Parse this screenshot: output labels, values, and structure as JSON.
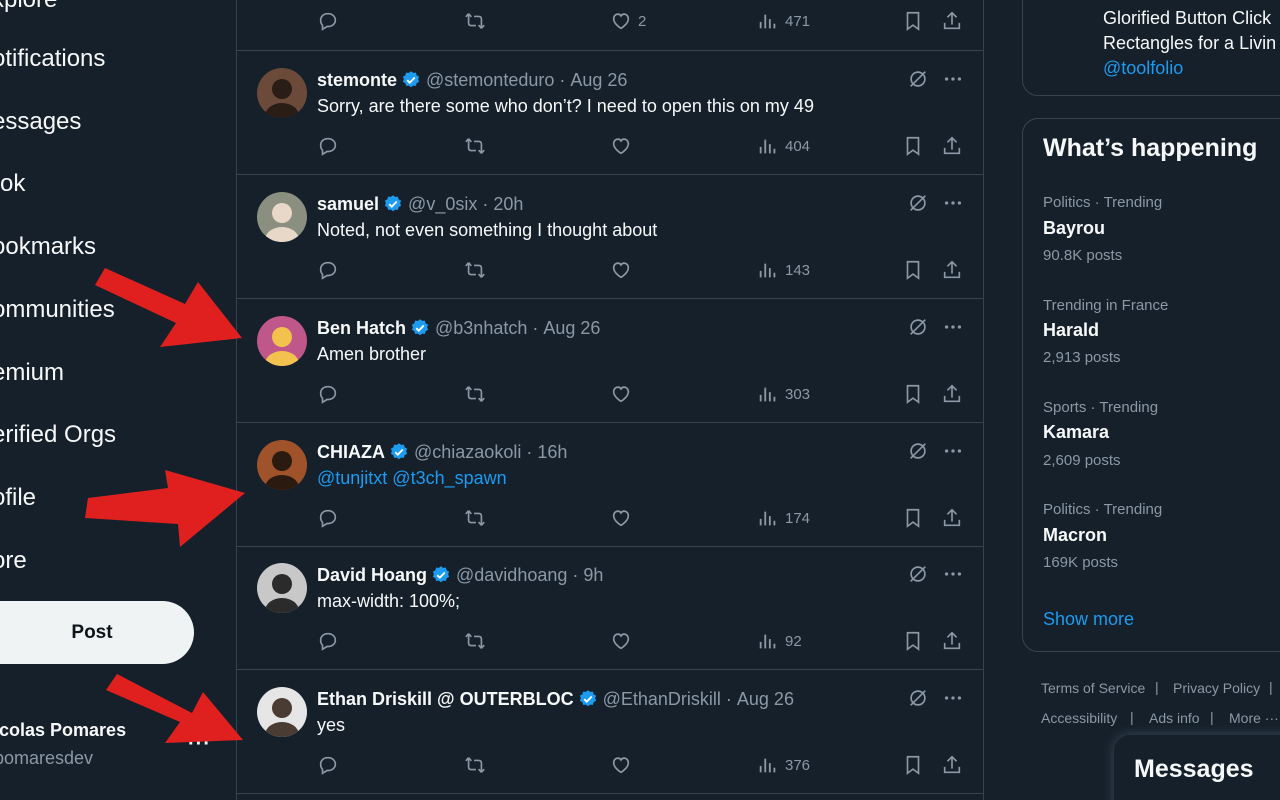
{
  "nav": {
    "items": [
      {
        "label": "xplore"
      },
      {
        "label": "otifications"
      },
      {
        "label": "essages"
      },
      {
        "label": "rok"
      },
      {
        "label": "ookmarks"
      },
      {
        "label": "ommunities"
      },
      {
        "label": "emium"
      },
      {
        "label": "erified Orgs"
      },
      {
        "label": "ofile"
      },
      {
        "label": "ore"
      }
    ],
    "post_label": "Post",
    "account_name": "icolas Pomares",
    "account_handle": "pomaresdev",
    "account_more": "···"
  },
  "feed": {
    "top_actions": {
      "likes": "2",
      "views": "471"
    },
    "tweets": [
      {
        "name": "stemonte",
        "handle": "@stemonteduro",
        "dot": "·",
        "time": "Aug 26",
        "text": "Sorry, are there some who don’t? I need to open this on my 49",
        "views": "404"
      },
      {
        "name": "samuel",
        "handle": "@v_0six",
        "dot": "·",
        "time": "20h",
        "text": "Noted, not even something I thought about",
        "views": "143"
      },
      {
        "name": "Ben Hatch",
        "handle": "@b3nhatch",
        "dot": "·",
        "time": "Aug 26",
        "text": "Amen brother",
        "views": "303"
      },
      {
        "name": "CHIAZA",
        "handle": "@chiazaokoli",
        "dot": "·",
        "time": "16h",
        "text": "@tunjitxt @t3ch_spawn",
        "views": "174"
      },
      {
        "name": "David Hoang",
        "handle": "@davidhoang",
        "dot": "·",
        "time": "9h",
        "text": "max-width: 100%;",
        "views": "92"
      },
      {
        "name": "Ethan Driskill @ OUTERBLOC",
        "handle": "@EthanDriskill",
        "dot": "·",
        "time": "Aug 26",
        "text": "yes",
        "views": "376"
      }
    ]
  },
  "promo": {
    "line1": "Glorified Button Click",
    "line2": "Rectangles for a Livin",
    "link": "@toolfolio"
  },
  "trends": {
    "title": "What’s happening",
    "items": [
      {
        "context": "Politics · Trending",
        "name": "Bayrou",
        "count": "90.8K posts"
      },
      {
        "context": "Trending in France",
        "name": "Harald",
        "count": "2,913 posts"
      },
      {
        "context": "Sports · Trending",
        "name": "Kamara",
        "count": "2,609 posts"
      },
      {
        "context": "Politics · Trending",
        "name": "Macron",
        "count": "169K posts"
      }
    ],
    "show_more": "Show more"
  },
  "footer": {
    "terms": "Terms of Service",
    "privacy": "Privacy Policy",
    "accessibility": "Accessibility",
    "ads": "Ads info",
    "more": "More ···",
    "sep": "|"
  },
  "messages_drawer": {
    "title": "Messages"
  },
  "colors": {
    "background": "#15202b",
    "accent": "#1d9bf0",
    "verified": "#1d9bf0",
    "annotation_arrow": "#e0201f",
    "secondary_text": "#8b98a5",
    "border": "#38444d"
  }
}
